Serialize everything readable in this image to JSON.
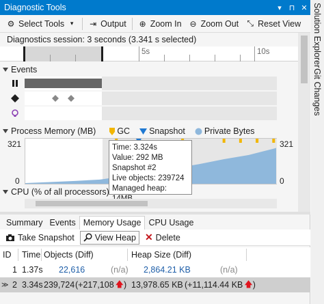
{
  "window": {
    "title": "Diagnostic Tools",
    "buttons": [
      "▾",
      "⊓",
      "✕"
    ]
  },
  "toolbar": {
    "select_tools": "Select Tools",
    "output": "Output",
    "zoom_in": "Zoom In",
    "zoom_out": "Zoom Out",
    "reset_view": "Reset View"
  },
  "session": {
    "text": "Diagnostics session: 3 seconds (3.341 s selected)"
  },
  "ruler": {
    "labels": [
      "5s",
      "10s"
    ]
  },
  "events": {
    "title": "Events"
  },
  "memory": {
    "title": "Process Memory (MB)",
    "legend": [
      "GC",
      "Snapshot",
      "Private Bytes"
    ],
    "y_max_left": "321",
    "y_min_left": "0",
    "y_max_right": "321",
    "y_min_right": "0",
    "colors": {
      "gc": "#f2b600",
      "snapshot": "#1e78d2",
      "private_bytes": "#8fb8dc"
    }
  },
  "tooltip": {
    "time": "Time: 3.324s",
    "value": "Value: 292 MB",
    "snapshot": "Snapshot #2",
    "live_objects": "Live objects: 239724",
    "managed_heap": "Managed heap: 14MB"
  },
  "cpu": {
    "title": "CPU (% of all processors)"
  },
  "tabs": [
    "Summary",
    "Events",
    "Memory Usage",
    "CPU Usage"
  ],
  "subtoolbar": {
    "take_snapshot": "Take Snapshot",
    "view_heap": "View Heap",
    "delete": "Delete"
  },
  "table": {
    "headers": [
      "ID",
      "Time",
      "Objects (Diff)",
      "Heap Size (Diff)"
    ],
    "rows": [
      {
        "id": "1",
        "time": "1.37s",
        "objects": "22,616",
        "objects_diff": "(n/a)",
        "heap": "2,864.21 KB",
        "heap_diff": "(n/a)"
      },
      {
        "id": "2",
        "time": "3.34s",
        "objects": "239,724",
        "objects_diff": "(+217,108",
        "heap": "13,978.65 KB",
        "heap_diff": "(+11,114.44 KB"
      }
    ]
  },
  "side_panel": {
    "items": [
      "Solution Explorer",
      "Git Changes"
    ]
  },
  "chart_data": {
    "type": "area",
    "title": "Process Memory (MB)",
    "series": [
      {
        "name": "Private Bytes",
        "x": [
          0.0,
          0.3,
          0.6,
          0.9,
          1.2,
          1.5,
          1.8,
          2.1,
          2.4,
          2.7,
          3.0,
          3.2,
          3.324
        ],
        "values": [
          5,
          12,
          20,
          30,
          55,
          80,
          110,
          140,
          175,
          205,
          250,
          285,
          292
        ]
      }
    ],
    "ylim": [
      0,
      321
    ],
    "xlim": [
      0,
      10
    ]
  }
}
